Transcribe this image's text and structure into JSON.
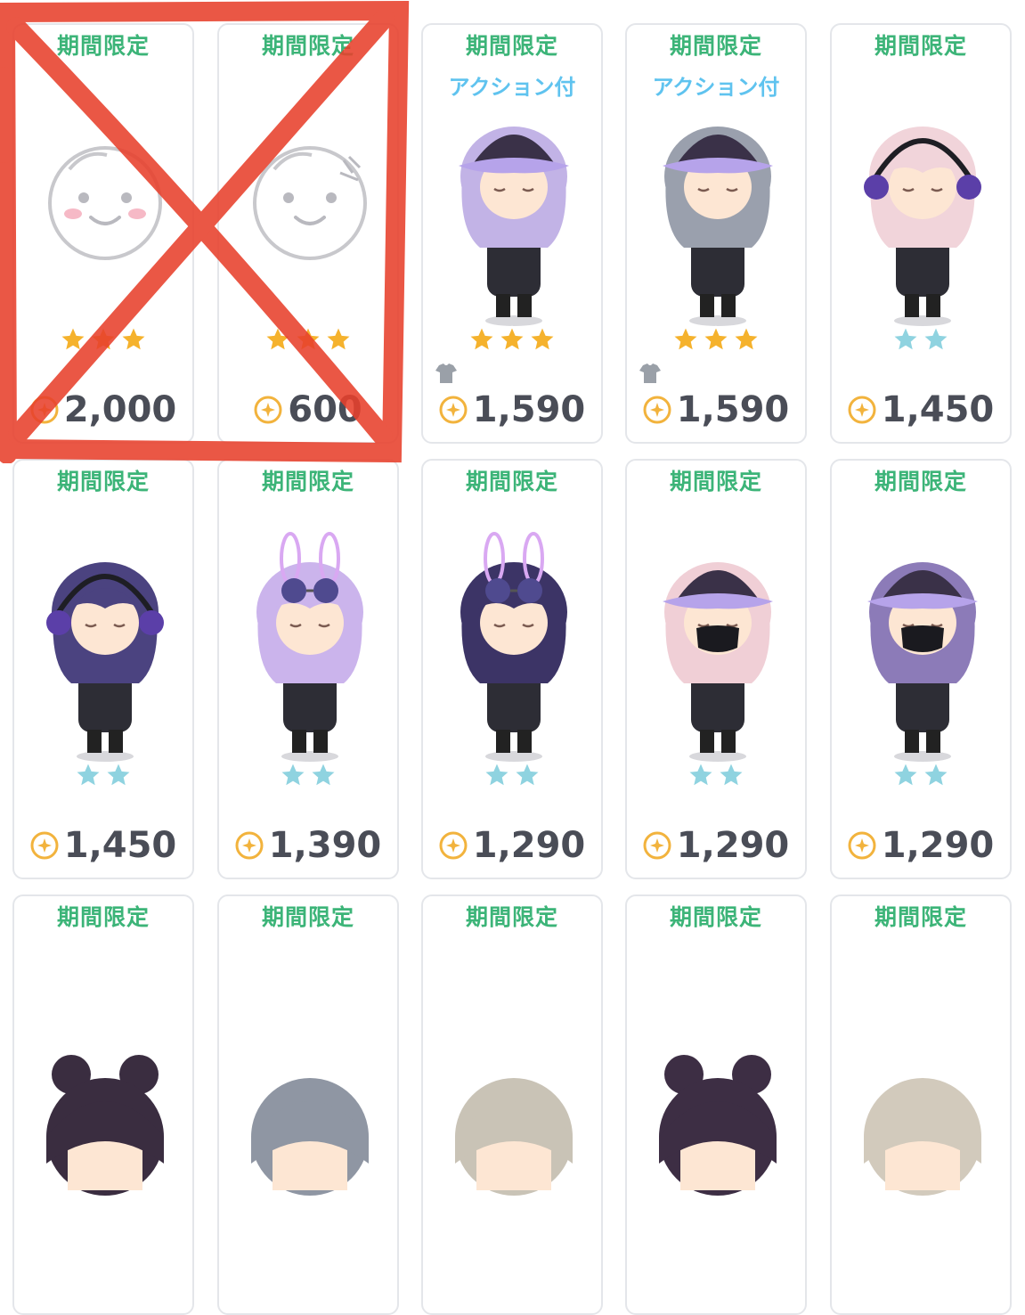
{
  "colors": {
    "tag_green": "#3cb478",
    "action_blue": "#5fc3ef",
    "star_gold": "#f5b22d",
    "star_blue": "#8fd3e0",
    "price_gray": "#4a4d57",
    "card_border": "#e4e6ea",
    "cross_red": "#e8402c"
  },
  "items": [
    {
      "tag": "期間限定",
      "action": "",
      "avatar": "blank-face-blush",
      "stars": "3",
      "star_color": "gold",
      "shirt_icon": false,
      "price": "2,000"
    },
    {
      "tag": "期間限定",
      "action": "",
      "avatar": "blank-face-pin",
      "stars": "3",
      "star_color": "gold",
      "shirt_icon": false,
      "price": "600"
    },
    {
      "tag": "期間限定",
      "action": "アクション付",
      "avatar": "lilac-hair-cap",
      "stars": "3",
      "star_color": "gold",
      "shirt_icon": true,
      "price": "1,590"
    },
    {
      "tag": "期間限定",
      "action": "アクション付",
      "avatar": "gray-hair-cap",
      "stars": "3",
      "star_color": "gold",
      "shirt_icon": true,
      "price": "1,590"
    },
    {
      "tag": "期間限定",
      "action": "",
      "avatar": "pink-hair-headphones",
      "stars": "2",
      "star_color": "blue",
      "shirt_icon": false,
      "price": "1,450"
    },
    {
      "tag": "期間限定",
      "action": "",
      "avatar": "purple-hair-headphones",
      "stars": "2",
      "star_color": "blue",
      "shirt_icon": false,
      "price": "1,450"
    },
    {
      "tag": "期間限定",
      "action": "",
      "avatar": "lilac-bunny-sunglasses",
      "stars": "2",
      "star_color": "blue",
      "shirt_icon": false,
      "price": "1,390"
    },
    {
      "tag": "期間限定",
      "action": "",
      "avatar": "navy-bunny-sunglasses",
      "stars": "2",
      "star_color": "blue",
      "shirt_icon": false,
      "price": "1,290"
    },
    {
      "tag": "期間限定",
      "action": "",
      "avatar": "pink-hair-cap-mask",
      "stars": "2",
      "star_color": "blue",
      "shirt_icon": false,
      "price": "1,290"
    },
    {
      "tag": "期間限定",
      "action": "",
      "avatar": "purple-hair-cap-mask",
      "stars": "2",
      "star_color": "blue",
      "shirt_icon": false,
      "price": "1,290"
    },
    {
      "tag": "期間限定",
      "action": "",
      "avatar": "dark-bun-hair",
      "stars": "",
      "star_color": "",
      "shirt_icon": false,
      "price": ""
    },
    {
      "tag": "期間限定",
      "action": "",
      "avatar": "gray-short-hair",
      "stars": "",
      "star_color": "",
      "shirt_icon": false,
      "price": ""
    },
    {
      "tag": "期間限定",
      "action": "",
      "avatar": "ash-beige-hair",
      "stars": "",
      "star_color": "",
      "shirt_icon": false,
      "price": ""
    },
    {
      "tag": "期間限定",
      "action": "",
      "avatar": "dark-small-bun-hair",
      "stars": "",
      "star_color": "",
      "shirt_icon": false,
      "price": ""
    },
    {
      "tag": "期間限定",
      "action": "",
      "avatar": "beige-hair",
      "stars": "",
      "star_color": "",
      "shirt_icon": false,
      "price": ""
    }
  ]
}
